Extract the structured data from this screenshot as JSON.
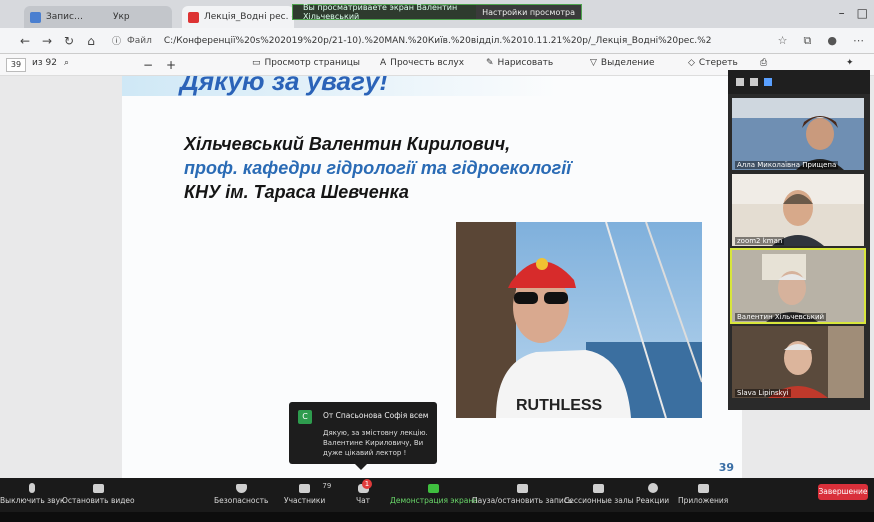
{
  "browser": {
    "tabs": [
      {
        "label": "Запис…",
        "active": false
      },
      {
        "label": "Лекція_Водні рес. -глоб…",
        "active": true
      }
    ],
    "tab_extra_label": "Укр",
    "share_notice": "Вы просматриваете экран Валентин Хільчевський",
    "view_options": "Настройки просмотра",
    "address_prefix": "Файл",
    "address": "C:/Конференції%20s%202019%20p/21-10).%20MAN.%20Київ.%20відділ.%2010.11.21%20p/_Лекція_Водні%20рес.%20-глоб..%20Укр…"
  },
  "pdf_toolbar": {
    "page_current": "39",
    "page_total": "из 92",
    "zoom_out": "−",
    "zoom_in": "+",
    "page_view": "Просмотр страницы",
    "read_aloud": "Прочесть вслух",
    "draw": "Нарисовать",
    "highlight": "Выделение",
    "erase": "Стереть"
  },
  "slide": {
    "title_partial": "Дякую за увагу!",
    "line1": "Хільчевський Валентин Кирилович,",
    "line2": "проф. кафедри гідрології та гідроекології",
    "line3": "КНУ ім. Тараса Шевченка",
    "page_number": "39"
  },
  "participants": [
    {
      "name": "Алла Миколаївна Прищепа",
      "active": false
    },
    {
      "name": "zoom2 kman",
      "active": false
    },
    {
      "name": "Валентин Хільчевський",
      "active": true
    },
    {
      "name": "Slava Lipinskyi",
      "active": false
    }
  ],
  "chat_popup": {
    "avatar_letter": "С",
    "from": "От Спасьонова Софія всем",
    "message": "Дякую, за змістовну лекцію. Валентине Кириловичу, Ви дуже цікавий лектор !"
  },
  "zoom_toolbar": {
    "mute": "Выключить звук",
    "stop_video": "Остановить видео",
    "security": "Безопасность",
    "participants": "Участники",
    "participants_count": "79",
    "chat": "Чат",
    "chat_badge": "1",
    "share_screen": "Демонстрация экрана",
    "pause_record": "Пауза/остановить запись",
    "breakout_rooms": "Сессионные залы",
    "reactions": "Реакции",
    "apps": "Приложения",
    "end": "Завершение"
  },
  "colors": {
    "slide_blue": "#2a6bb5",
    "share_green": "#3fbf3f",
    "end_red": "#d9303a",
    "active_speaker": "#d8e63c"
  }
}
